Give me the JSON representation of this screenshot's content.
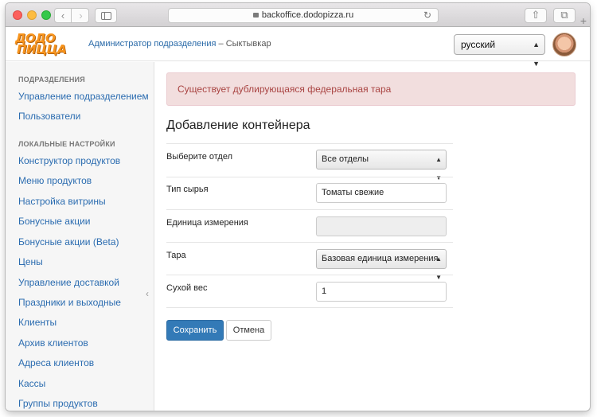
{
  "browser": {
    "url": "backoffice.dodopizza.ru",
    "icons": {
      "back": "chevron-left-icon",
      "forward": "chevron-right-icon",
      "sidebar": "sidebar-icon",
      "reload": "reload-icon",
      "share": "share-icon",
      "tabs": "tabs-icon",
      "new_tab": "plus-icon"
    }
  },
  "header": {
    "logo_line1": "ДОДО",
    "logo_line2": "ПИЦЦА",
    "breadcrumb_role": "Администратор подразделения",
    "breadcrumb_sep": " – ",
    "breadcrumb_city": "Сыктывкар",
    "language": "русский"
  },
  "sidebar": {
    "section1_title": "ПОДРАЗДЕЛЕНИЯ",
    "section1_items": [
      "Управление подразделением",
      "Пользователи"
    ],
    "section2_title": "ЛОКАЛЬНЫЕ НАСТРОЙКИ",
    "section2_items": [
      "Конструктор продуктов",
      "Меню продуктов",
      "Настройка витрины",
      "Бонусные акции",
      "Бонусные акции (Beta)",
      "Цены",
      "Управление доставкой",
      "Праздники и выходные",
      "Клиенты",
      "Архив клиентов",
      "Адреса клиентов",
      "Кассы",
      "Группы продуктов"
    ]
  },
  "alert": {
    "text": "Существует дублирующаяся федеральная тара",
    "color": "#a94442"
  },
  "form": {
    "title": "Добавление контейнера",
    "fields": [
      {
        "label": "Выберите отдел",
        "type": "select",
        "value": "Все отделы"
      },
      {
        "label": "Тип сырья",
        "type": "input",
        "value": "Томаты свежие"
      },
      {
        "label": "Единица измерения",
        "type": "disabled",
        "value": ""
      },
      {
        "label": "Тара",
        "type": "select",
        "value": "Базовая единица измерения"
      },
      {
        "label": "Сухой вес",
        "type": "input",
        "value": "1"
      }
    ],
    "save_label": "Сохранить",
    "cancel_label": "Отмена"
  },
  "colors": {
    "primary": "#337ab7",
    "link": "#2b6cb0",
    "brand": "#f7941d",
    "alert_bg": "#f2dede"
  }
}
